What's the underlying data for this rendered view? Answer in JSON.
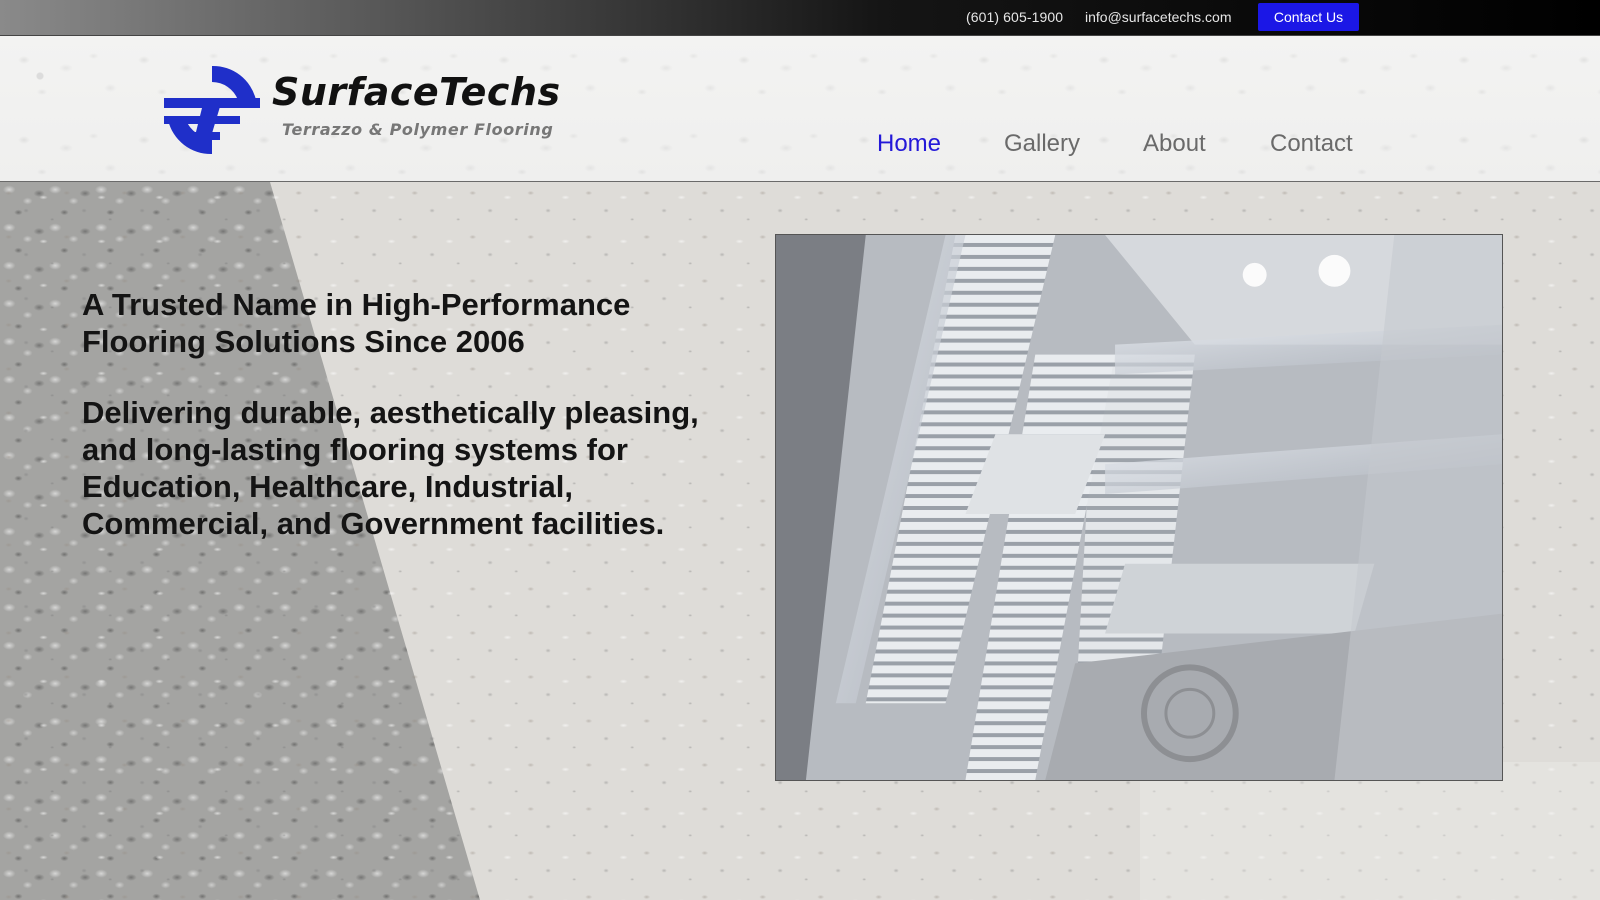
{
  "topbar": {
    "phone": "(601) 605-1900",
    "email": "info@surfacetechs.com",
    "contact_button": "Contact Us"
  },
  "header": {
    "brand": "SurfaceTechs",
    "tagline": "Terrazzo & Polymer Flooring",
    "nav": [
      {
        "label": "Home",
        "active": true
      },
      {
        "label": "Gallery",
        "active": false
      },
      {
        "label": "About",
        "active": false
      },
      {
        "label": "Contact",
        "active": false
      }
    ]
  },
  "hero": {
    "heading": "A Trusted Name in High-Performance Flooring Solutions Since 2006",
    "subheading": "Delivering durable, aesthetically pleasing, and long-lasting flooring systems for Education, Healthcare, Industrial, Commercial, and Government facilities.",
    "photo_icon": "staircase-photo"
  },
  "colors": {
    "accent": "#1b17e6",
    "nav_active": "#2419d8",
    "nav_inactive": "#6a6a6a"
  }
}
